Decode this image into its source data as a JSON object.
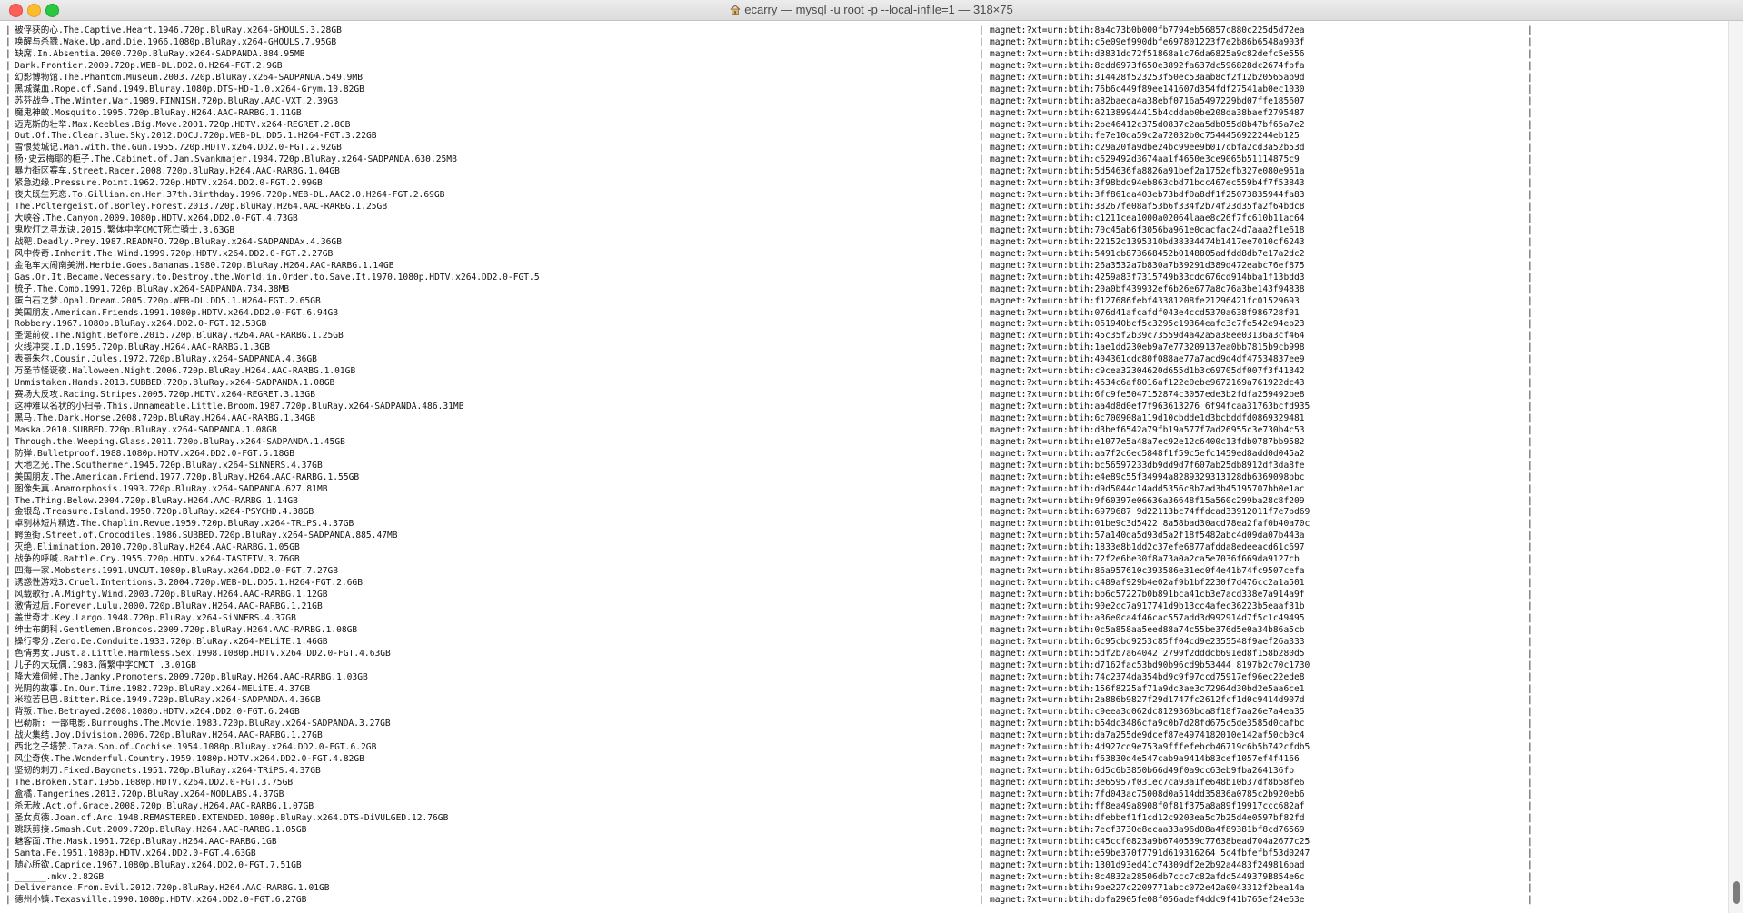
{
  "window": {
    "title": "ecarry — mysql -u root -p --local-infile=1 — 318×75",
    "icon": "home-icon"
  },
  "terminal": {
    "separator": "|",
    "rows": [
      {
        "name": "被俘获的心.The.Captive.Heart.1946.720p.BluRay.x264-GHOULS.3.28GB",
        "magnet": "magnet:?xt=urn:btih:8a4c73b0b000fb7794eb56857c880c225d5d72ea"
      },
      {
        "name": "唤醒与杀戮.Wake.Up.and.Die.1966.1080p.BluRay.x264-GHOULS.7.95GB",
        "magnet": "magnet:?xt=urn:btih:c5e09ef990dbfe697801223f7e2b86b6548a903f"
      },
      {
        "name": "缺席.In.Absentia.2000.720p.BluRay.x264-SADPANDA.884.95MB",
        "magnet": "magnet:?xt=urn:btih:d3831dd72f51868a1c76da6825a9c82defc5e556"
      },
      {
        "name": "Dark.Frontier.2009.720p.WEB-DL.DD2.0.H264-FGT.2.9GB",
        "magnet": "magnet:?xt=urn:btih:8cdd6973f650e3892fa637dc596828dc2674fbfa"
      },
      {
        "name": "幻影博物馆.The.Phantom.Museum.2003.720p.BluRay.x264-SADPANDA.549.9MB",
        "magnet": "magnet:?xt=urn:btih:314428f523253f50ec53aab8cf2f12b20565ab9d"
      },
      {
        "name": "黑城谋血.Rope.of.Sand.1949.Bluray.1080p.DTS-HD-1.0.x264-Grym.10.82GB",
        "magnet": "magnet:?xt=urn:btih:76b6c449f89ee141607d354fdf27541ab0ec1030"
      },
      {
        "name": "苏芬战争.The.Winter.War.1989.FINNISH.720p.BluRay.AAC-VXT.2.39GB",
        "magnet": "magnet:?xt=urn:btih:a82baeca4a38ebf0716a5497229bd07ffe185607"
      },
      {
        "name": "魔鬼神蚊.Mosquito.1995.720p.BluRay.H264.AAC-RARBG.1.11GB",
        "magnet": "magnet:?xt=urn:btih:621389944415b4cddab0be208da38baef2795487"
      },
      {
        "name": "迈克斯的壮举.Max.Keebles.Big.Move.2001.720p.HDTV.x264-REGRET.2.8GB",
        "magnet": "magnet:?xt=urn:btih:2be46412c375d0837c2aa5db055d8b47bf65a7e2"
      },
      {
        "name": "Out.Of.The.Clear.Blue.Sky.2012.DOCU.720p.WEB-DL.DD5.1.H264-FGT.3.22GB",
        "magnet": "magnet:?xt=urn:btih:fe7e10da59c2a72032b0c7544456922244eb125"
      },
      {
        "name": "雪恨焚城记.Man.with.the.Gun.1955.720p.HDTV.x264.DD2.0-FGT.2.92GB",
        "magnet": "magnet:?xt=urn:btih:c29a20fa9dbe24bc99ee9b017cbfa2cd3a52b53d"
      },
      {
        "name": "杨·史云梅耶的柜子.The.Cabinet.of.Jan.Svankmajer.1984.720p.BluRay.x264-SADPANDA.630.25MB",
        "magnet": "magnet:?xt=urn:btih:c629492d3674aa1f4650e3ce9065b51114875c9"
      },
      {
        "name": "暴力街区赛车.Street.Racer.2008.720p.BluRay.H264.AAC-RARBG.1.04GB",
        "magnet": "magnet:?xt=urn:btih:5d54636fa8826a91bef2a1752efb327e080e951a"
      },
      {
        "name": "紧急边缘.Pressure.Point.1962.720p.HDTV.x264.DD2.0-FGT.2.99GB",
        "magnet": "magnet:?xt=urn:btih:3f98bdd94eb863cbd71bcc467ec559b4f7f53843"
      },
      {
        "name": "夜夫既生死恋.To.Gillian.on.Her.37th.Birthday.1996.720p.WEB-DL.AAC2.0.H264-FGT.2.69GB",
        "magnet": "magnet:?xt=urn:btih:3ff861da403eb73bdf0a8df1f25073835944fa83"
      },
      {
        "name": "The.Poltergeist.of.Borley.Forest.2013.720p.BluRay.H264.AAC-RARBG.1.25GB",
        "magnet": "magnet:?xt=urn:btih:38267fe08af53b6f334f2b74f23d35fa2f64bdc8"
      },
      {
        "name": "大峡谷.The.Canyon.2009.1080p.HDTV.x264.DD2.0-FGT.4.73GB",
        "magnet": "magnet:?xt=urn:btih:c1211cea1000a02064laae8c26f7fc610b11ac64"
      },
      {
        "name": "鬼吹灯之寻龙诀.2015.繁体中字CMCT死亡骑士.3.63GB",
        "magnet": "magnet:?xt=urn:btih:70c45ab6f3056ba961e0cacfac24d7aaa2f1e618"
      },
      {
        "name": "战靶.Deadly.Prey.1987.READNFO.720p.BluRay.x264-SADPANDAx.4.36GB",
        "magnet": "magnet:?xt=urn:btih:22152c1395310bd38334474b1417ee7010cf6243"
      },
      {
        "name": "风中传奇.Inherit.The.Wind.1999.720p.HDTV.x264.DD2.0-FGT.2.27GB",
        "magnet": "magnet:?xt=urn:btih:5491cb873668452b0148805adfdd8db7e17a2dc2"
      },
      {
        "name": "金龟车大闹南美洲.Herbie.Goes.Bananas.1980.720p.BluRay.H264.AAC-RARBG.1.14GB",
        "magnet": "magnet:?xt=urn:btih:26a3532a7b830a7b39291d389d472eabc76ef875"
      },
      {
        "name": "Gas.Or.It.Became.Necessary.to.Destroy.the.World.in.Order.to.Save.It.1970.1080p.HDTV.x264.DD2.0-FGT.5",
        "magnet": "magnet:?xt=urn:btih:4259a83f7315749b33cdc676cd914bba1f13bdd3"
      },
      {
        "name": "梳子.The.Comb.1991.720p.BluRay.x264-SADPANDA.734.38MB",
        "magnet": "magnet:?xt=urn:btih:20a0bf439932ef6b26e677a8c76a3be143f94838"
      },
      {
        "name": "蛋白石之梦.Opal.Dream.2005.720p.WEB-DL.DD5.1.H264-FGT.2.65GB",
        "magnet": "magnet:?xt=urn:btih:f127686febf43381208fe21296421fc01529693"
      },
      {
        "name": "美国朋友.American.Friends.1991.1080p.HDTV.x264.DD2.0-FGT.6.94GB",
        "magnet": "magnet:?xt=urn:btih:076d41afcafdf043e4ccd5370a638f986728f01"
      },
      {
        "name": "Robbery.1967.1080p.BluRay.x264.DD2.0-FGT.12.53GB",
        "magnet": "magnet:?xt=urn:btih:061940bcf5c3295c19364eafc3c7fe542e94eb23"
      },
      {
        "name": "圣诞前夜.The.Night.Before.2015.720p.BluRay.H264.AAC-RARBG.1.25GB",
        "magnet": "magnet:?xt=urn:btih:45c35f2b39c73559d4a42a5a38ee03136a3cf464"
      },
      {
        "name": "火线冲突.I.D.1995.720p.BluRay.H264.AAC-RARBG.1.3GB",
        "magnet": "magnet:?xt=urn:btih:1ae1dd230eb9a7e773209137ea0bb7815b9cb998"
      },
      {
        "name": "表哥朱尔.Cousin.Jules.1972.720p.BluRay.x264-SADPANDA.4.36GB",
        "magnet": "magnet:?xt=urn:btih:404361cdc80f088ae77a7acd9d4df47534837ee9"
      },
      {
        "name": "万圣节怪诞夜.Halloween.Night.2006.720p.BluRay.H264.AAC-RARBG.1.01GB",
        "magnet": "magnet:?xt=urn:btih:c9cea32304620d655d1b3c69705df007f3f41342"
      },
      {
        "name": "Unmistaken.Hands.2013.SUBBED.720p.BluRay.x264-SADPANDA.1.08GB",
        "magnet": "magnet:?xt=urn:btih:4634c6af8016af122e0ebe9672169a761922dc43"
      },
      {
        "name": "赛场大反攻.Racing.Stripes.2005.720p.HDTV.x264-REGRET.3.13GB",
        "magnet": "magnet:?xt=urn:btih:6fc9fe5047152874c3057ede3b2fdfa259492be8"
      },
      {
        "name": "这种难以名状的小扫帚.This.Unnameable.Little.Broom.1987.720p.BluRay.x264-SADPANDA.486.31MB",
        "magnet": "magnet:?xt=urn:btih:aa4d8d0ef7f963613276 6f94fcaa31763bcfd935"
      },
      {
        "name": "黑马.The.Dark.Horse.2008.720p.BluRay.H264.AAC-RARBG.1.34GB",
        "magnet": "magnet:?xt=urn:btih:6c700908a119d10cbdde1d3bcbddfd0869329481"
      },
      {
        "name": "Maska.2010.SUBBED.720p.BluRay.x264-SADPANDA.1.08GB",
        "magnet": "magnet:?xt=urn:btih:d3bef6542a79fb19a577f7ad26955c3e730b4c53"
      },
      {
        "name": "Through.the.Weeping.Glass.2011.720p.BluRay.x264-SADPANDA.1.45GB",
        "magnet": "magnet:?xt=urn:btih:e1077e5a48a7ec92e12c6400c13fdb0787bb9582"
      },
      {
        "name": "防弹.Bulletproof.1988.1080p.HDTV.x264.DD2.0-FGT.5.18GB",
        "magnet": "magnet:?xt=urn:btih:aa7f2c6ec5848f1f59c5efc1459ed8add0d045a2"
      },
      {
        "name": "大地之光.The.Southerner.1945.720p.BluRay.x264-SiNNERS.4.37GB",
        "magnet": "magnet:?xt=urn:btih:bc56597233db9dd9d7f607ab25db8912df3da8fe"
      },
      {
        "name": "美国朋友.The.American.Friend.1977.720p.BluRay.H264.AAC-RARBG.1.55GB",
        "magnet": "magnet:?xt=urn:btih:e4e89c55f34994a8289329313128db6369098bbc"
      },
      {
        "name": "图像失真.Anamorphosis.1993.720p.BluRay.x264-SADPANDA.627.81MB",
        "magnet": "magnet:?xt=urn:btih:d9d5044c14add5356c8b7ad3b45195707bb0e1ac"
      },
      {
        "name": "The.Thing.Below.2004.720p.BluRay.H264.AAC-RARBG.1.14GB",
        "magnet": "magnet:?xt=urn:btih:9f60397e06636a36648f15a560c299ba28c8f209"
      },
      {
        "name": "金银岛.Treasure.Island.1950.720p.BluRay.x264-PSYCHD.4.38GB",
        "magnet": "magnet:?xt=urn:btih:6979687 9d22113bc74ffdcad33912011f7e7bd69"
      },
      {
        "name": "卓别林短片精选.The.Chaplin.Revue.1959.720p.BluRay.x264-TRiPS.4.37GB",
        "magnet": "magnet:?xt=urn:btih:01be9c3d5422 8a58bad30acd78ea2faf0b40a70c"
      },
      {
        "name": "鳄鱼街.Street.of.Crocodiles.1986.SUBBED.720p.BluRay.x264-SADPANDA.885.47MB",
        "magnet": "magnet:?xt=urn:btih:57a140da5d93d5a2f18f5482abc4d09da07b443a"
      },
      {
        "name": "灭绝.Elimination.2010.720p.BluRay.H264.AAC-RARBG.1.05GB",
        "magnet": "magnet:?xt=urn:btih:1833e8b1dd2c37efe6877afdda8edeeacd61c697"
      },
      {
        "name": "战争的呼喊.Battle.Cry.1955.720p.HDTV.x264-TASTETV.3.76GB",
        "magnet": "magnet:?xt=urn:btih:72f2e6be30f8a73a0a2ca5e7036f669da9127cb"
      },
      {
        "name": "四海一家.Mobsters.1991.UNCUT.1080p.BluRay.x264.DD2.0-FGT.7.27GB",
        "magnet": "magnet:?xt=urn:btih:86a957610c393586e31ec0f4e41b74fc9507cefa"
      },
      {
        "name": "诱惑性游戏3.Cruel.Intentions.3.2004.720p.WEB-DL.DD5.1.H264-FGT.2.6GB",
        "magnet": "magnet:?xt=urn:btih:c489af929b4e02af9b1bf2230f7d476cc2a1a501"
      },
      {
        "name": "风载歌行.A.Mighty.Wind.2003.720p.BluRay.H264.AAC-RARBG.1.12GB",
        "magnet": "magnet:?xt=urn:btih:bb6c57227b0b891bca41cb3e7acd338e7a914a9f"
      },
      {
        "name": "激情过后.Forever.Lulu.2000.720p.BluRay.H264.AAC-RARBG.1.21GB",
        "magnet": "magnet:?xt=urn:btih:90e2cc7a917741d9b13cc4afec36223b5eaaf31b"
      },
      {
        "name": "盖世奇才.Key.Largo.1948.720p.BluRay.x264-SiNNERS.4.37GB",
        "magnet": "magnet:?xt=urn:btih:a36e0ca4f46cac557add3d992914d7f5c1c49495"
      },
      {
        "name": "绅士布朗科.Gentlemen.Broncos.2009.720p.BluRay.H264.AAC-RARBG.1.08GB",
        "magnet": "magnet:?xt=urn:btih:0c5a858aa5eed88a74c55be376d5e0a34b86a5cb"
      },
      {
        "name": "操行零分.Zero.De.Conduite.1933.720p.BluRay.x264-MELiTE.1.46GB",
        "magnet": "magnet:?xt=urn:btih:6c95cbd9253c85ff04cd9e2355548f9aef26a333"
      },
      {
        "name": "色情男女.Just.a.Little.Harmless.Sex.1998.1080p.HDTV.x264.DD2.0-FGT.4.63GB",
        "magnet": "magnet:?xt=urn:btih:5df2b7a64042 2799f2dddcb691ed8f158b280d5"
      },
      {
        "name": "儿子的大玩偶.1983.简繁中字CMCT_.3.01GB",
        "magnet": "magnet:?xt=urn:btih:d7162fac53bd90b96cd9b53444 8197b2c70c1730"
      },
      {
        "name": "降大难伺候.The.Janky.Promoters.2009.720p.BluRay.H264.AAC-RARBG.1.03GB",
        "magnet": "magnet:?xt=urn:btih:74c2374da354bd9c9f97ccd75917ef96ec22ede8"
      },
      {
        "name": "光阴的故事.In.Our.Time.1982.720p.BluRay.x264-MELiTE.4.37GB",
        "magnet": "magnet:?xt=urn:btih:156f8225af71a9dc3ae3c72964d30bd2e5aa6ce1"
      },
      {
        "name": "米粒苦巴巴.Bitter.Rice.1949.720p.BluRay.x264-SADPANDA.4.36GB",
        "magnet": "magnet:?xt=urn:btih:2a886b9827f29d1747fc2612fcf1d0c9414d907d"
      },
      {
        "name": "背叛.The.Betrayed.2008.1080p.HDTV.x264.DD2.0-FGT.6.24GB",
        "magnet": "magnet:?xt=urn:btih:c9eea3d062dc8129360bca8f18f7aa26e7a4ea35"
      },
      {
        "name": "巴勒斯: 一部电影.Burroughs.The.Movie.1983.720p.BluRay.x264-SADPANDA.3.27GB",
        "magnet": "magnet:?xt=urn:btih:b54dc3486cfa9c0b7d28fd675c5de3585d0cafbc"
      },
      {
        "name": "战火集结.Joy.Division.2006.720p.BluRay.H264.AAC-RARBG.1.27GB",
        "magnet": "magnet:?xt=urn:btih:da7a255de9dcef87e4974182010e142af50cb0c4"
      },
      {
        "name": "西北之子塔赞.Taza.Son.of.Cochise.1954.1080p.BluRay.x264.DD2.0-FGT.6.2GB",
        "magnet": "magnet:?xt=urn:btih:4d927cd9e753a9fffefebcb46719c6b5b742cfdb5"
      },
      {
        "name": "风尘奇侠.The.Wonderful.Country.1959.1080p.HDTV.x264.DD2.0-FGT.4.82GB",
        "magnet": "magnet:?xt=urn:btih:f63830d4e547cab9a9414b83cef1057ef4f4166"
      },
      {
        "name": "坚韧的刺刀.Fixed.Bayonets.1951.720p.BluRay.x264-TRiPS.4.37GB",
        "magnet": "magnet:?xt=urn:btih:6d5c6b3850b66d49f0a9cc63eb9fba264136fb"
      },
      {
        "name": "The.Broken.Star.1956.1080p.HDTV.x264.DD2.0-FGT.3.75GB",
        "magnet": "magnet:?xt=urn:btih:3e65957f031ec7ca93a1fe648b10b37df8b58fe6"
      },
      {
        "name": "盒橘.Tangerines.2013.720p.BluRay.x264-NODLABS.4.37GB",
        "magnet": "magnet:?xt=urn:btih:7fd043ac75008d0a514dd35836a0785c2b920eb6"
      },
      {
        "name": "杀无赦.Act.of.Grace.2008.720p.BluRay.H264.AAC-RARBG.1.07GB",
        "magnet": "magnet:?xt=urn:btih:ff8ea49a8908f0f81f375a8a89f19917ccc682af"
      },
      {
        "name": "圣女贞德.Joan.of.Arc.1948.REMASTERED.EXTENDED.1080p.BluRay.x264.DTS-DiVULGED.12.76GB",
        "magnet": "magnet:?xt=urn:btih:dfebbef1f1cd12c9203ea5c7b25d4e0597bf82fd"
      },
      {
        "name": "跳跃剪接.Smash.Cut.2009.720p.BluRay.H264.AAC-RARBG.1.05GB",
        "magnet": "magnet:?xt=urn:btih:7ecf3730e8ecaa33a96d08a4f89381bf8cd76569"
      },
      {
        "name": "魅客面.The.Mask.1961.720p.BluRay.H264.AAC-RARBG.1GB",
        "magnet": "magnet:?xt=urn:btih:c45ccf0823a9b6740539c77638bead704a2677c25"
      },
      {
        "name": "Santa.Fe.1951.1080p.HDTV.x264.DD2.0-FGT.4.63GB",
        "magnet": "magnet:?xt=urn:btih:e59be370f7791d619316264 5c4fbfefbf53d0247"
      },
      {
        "name": "随心所欲.Caprice.1967.1080p.BluRay.x264.DD2.0-FGT.7.51GB",
        "magnet": "magnet:?xt=urn:btih:1301d93ed41c74309df2e2b92a4483f249816bad"
      },
      {
        "name": "______.mkv.2.82GB",
        "magnet": "magnet:?xt=urn:btih:8c4832a28506db7ccc7c82afdc5449379B854e6c"
      },
      {
        "name": "Deliverance.From.Evil.2012.720p.BluRay.H264.AAC-RARBG.1.01GB",
        "magnet": "magnet:?xt=urn:btih:9be227c2209771abcc072e42a0043312f2bea14a"
      },
      {
        "name": "德州小镇.Texasville.1990.1080p.HDTV.x264.DD2.0-FGT.6.27GB",
        "magnet": "magnet:?xt=urn:btih:dbfa2905fe08f056adef4ddc9f41b765ef24e63e"
      }
    ]
  }
}
